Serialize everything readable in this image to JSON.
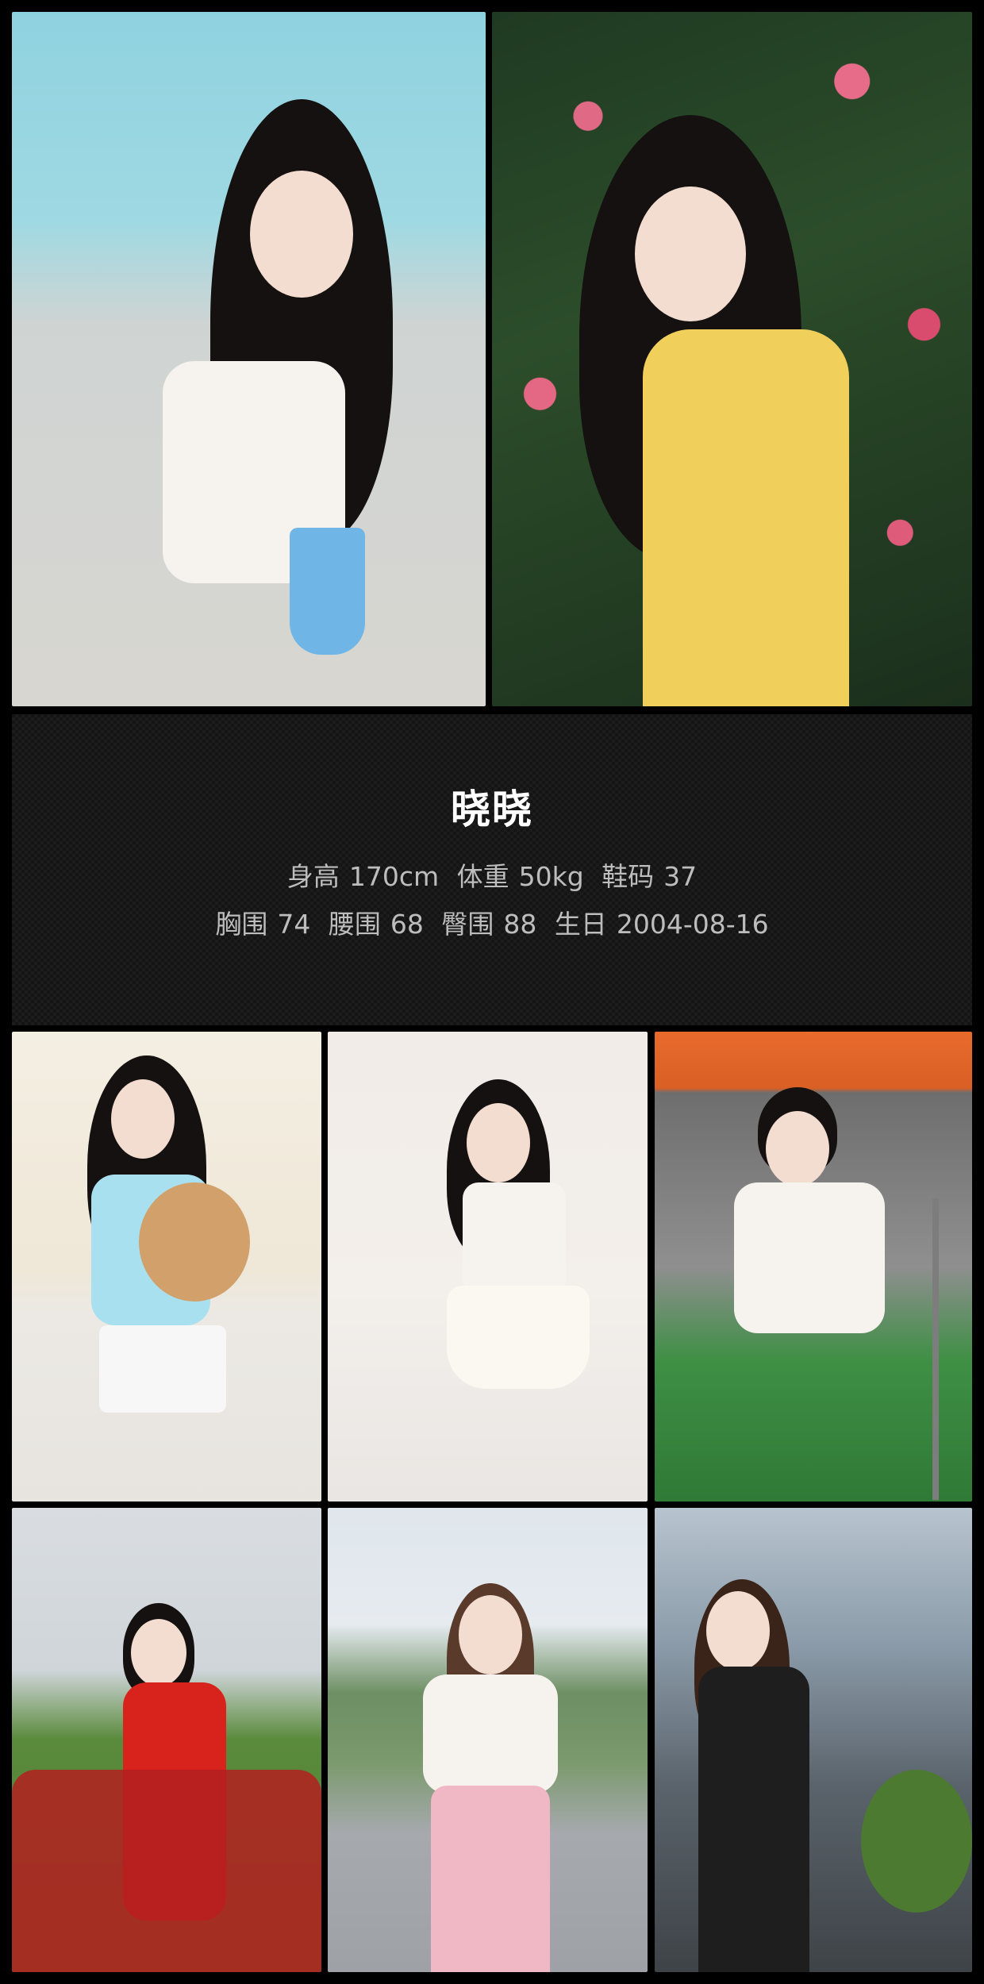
{
  "profile": {
    "name": "晓晓",
    "height_label": "身高",
    "height": "170cm",
    "weight_label": "体重",
    "weight": "50kg",
    "shoe_label": "鞋码",
    "shoe": "37",
    "bust_label": "胸围",
    "bust": "74",
    "waist_label": "腰围",
    "waist": "68",
    "hip_label": "臀围",
    "hip": "88",
    "birthday_label": "生日",
    "birthday": "2004-08-16"
  },
  "colors": {
    "background": "#000000",
    "panel": "#141414",
    "name_text": "#ffffff",
    "detail_text": "#bdbdbd"
  }
}
